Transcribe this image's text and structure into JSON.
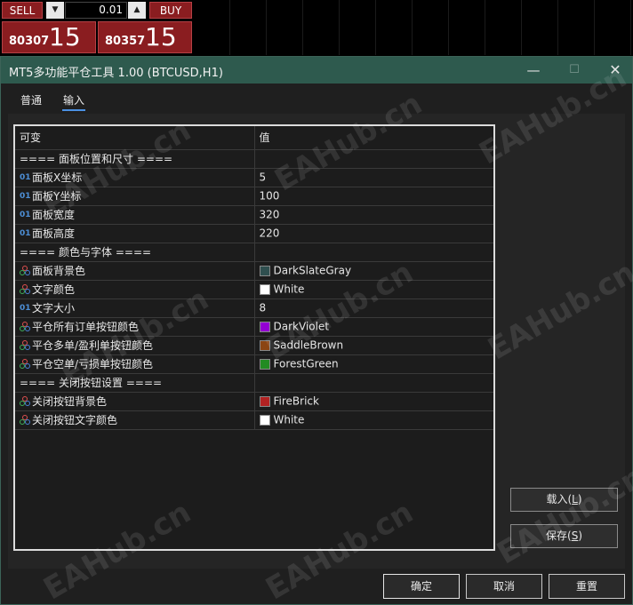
{
  "trade_panel": {
    "sell_label": "SELL",
    "buy_label": "BUY",
    "lot_value": "0.01",
    "sell_price_small": "80307",
    "sell_price_big": "15",
    "buy_price_small": "80357",
    "buy_price_big": "15"
  },
  "dialog": {
    "title": "MT5多功能平仓工具 1.00 (BTCUSD,H1)",
    "tabs": [
      {
        "label": "普通"
      },
      {
        "label": "输入"
      }
    ],
    "columns": {
      "variable": "可变",
      "value": "值"
    },
    "rows": [
      {
        "kind": "section",
        "name": "==== 面板位置和尺寸 ====",
        "value": ""
      },
      {
        "kind": "int",
        "name": "面板X坐标",
        "value": "5"
      },
      {
        "kind": "int",
        "name": "面板Y坐标",
        "value": "100"
      },
      {
        "kind": "int",
        "name": "面板宽度",
        "value": "320"
      },
      {
        "kind": "int",
        "name": "面板高度",
        "value": "220"
      },
      {
        "kind": "section",
        "name": "==== 颜色与字体 ====",
        "value": ""
      },
      {
        "kind": "color",
        "name": "面板背景色",
        "value": "DarkSlateGray",
        "swatch": "#2f4f4f"
      },
      {
        "kind": "color",
        "name": "文字颜色",
        "value": "White",
        "swatch": "#ffffff"
      },
      {
        "kind": "int",
        "name": "文字大小",
        "value": "8"
      },
      {
        "kind": "color",
        "name": "平仓所有订单按钮颜色",
        "value": "DarkViolet",
        "swatch": "#9400d3"
      },
      {
        "kind": "color",
        "name": "平仓多单/盈利单按钮颜色",
        "value": "SaddleBrown",
        "swatch": "#8b4513"
      },
      {
        "kind": "color",
        "name": "平仓空单/亏损单按钮颜色",
        "value": "ForestGreen",
        "swatch": "#228b22"
      },
      {
        "kind": "section",
        "name": "==== 关闭按钮设置 ====",
        "value": ""
      },
      {
        "kind": "color",
        "name": "关闭按钮背景色",
        "value": "FireBrick",
        "swatch": "#b22222"
      },
      {
        "kind": "color",
        "name": "关闭按钮文字颜色",
        "value": "White",
        "swatch": "#ffffff"
      }
    ],
    "int_badge": "01",
    "buttons": {
      "load": "载入(L)",
      "save": "保存(S)",
      "ok": "确定",
      "cancel": "取消",
      "reset": "重置"
    },
    "watermark": "EAHub.cn"
  }
}
